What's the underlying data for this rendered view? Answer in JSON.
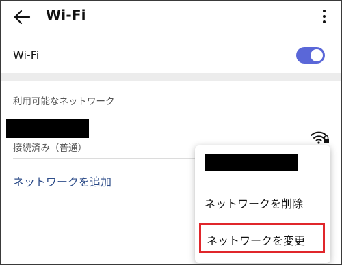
{
  "header": {
    "back_icon": "back-arrow-icon",
    "title": "Wi-Fi",
    "more_icon": "more-vert-icon"
  },
  "wifi_toggle": {
    "label": "Wi-Fi",
    "state": "on",
    "color": "#5a67d8"
  },
  "networks": {
    "section_header": "利用可能なネットワーク",
    "connected": {
      "status": "接続済み（普通）",
      "signal_icon": "wifi-signal-icon"
    },
    "add_network": "ネットワークを追加",
    "link_color": "#2f4e8a"
  },
  "context_menu": {
    "delete": "ネットワークを削除",
    "change": "ネットワークを変更",
    "highlight_color": "#e0262b"
  }
}
